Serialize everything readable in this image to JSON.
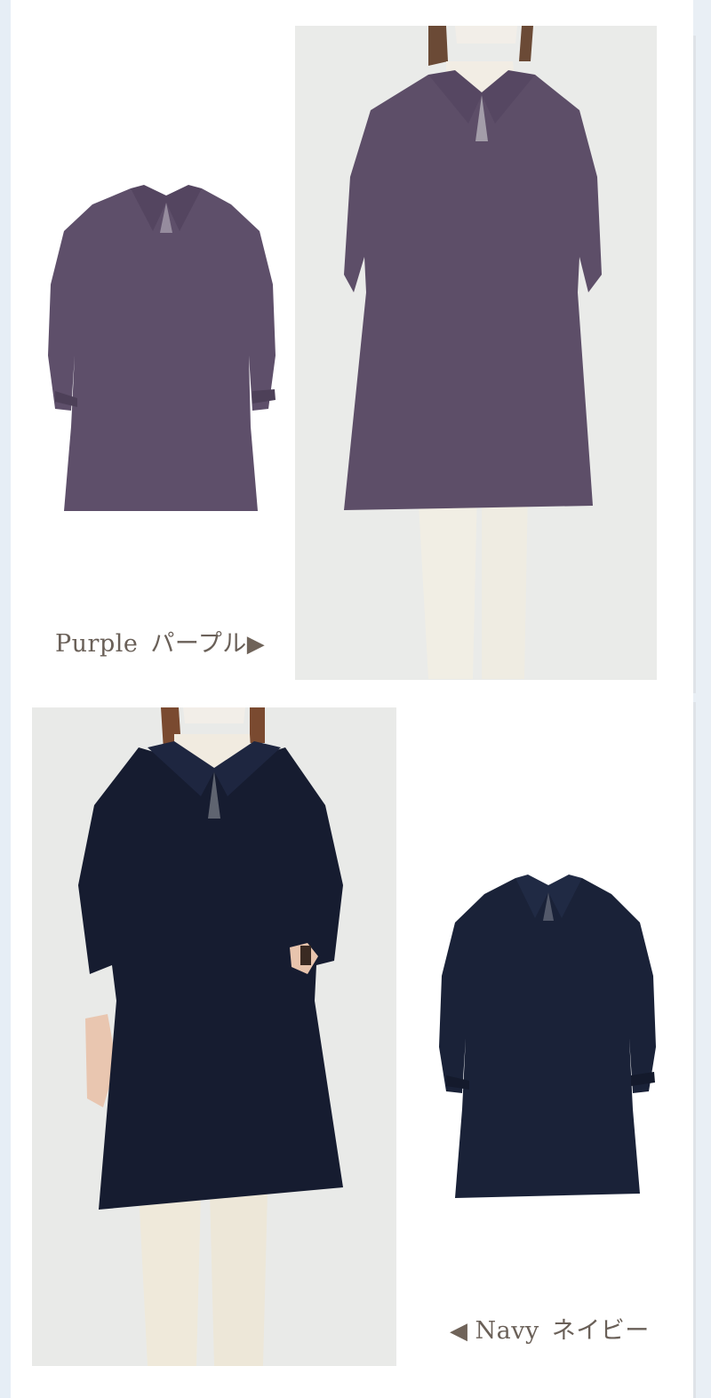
{
  "colors": {
    "purple": "#5e4f6a",
    "navy": "#1a2238",
    "label_text": "#6a6058"
  },
  "purple": {
    "label_en": "Purple",
    "label_ja": "パープル",
    "arrow": "▶"
  },
  "navy": {
    "arrow": "◀",
    "label_en": "Navy",
    "label_ja": "ネイビー"
  }
}
